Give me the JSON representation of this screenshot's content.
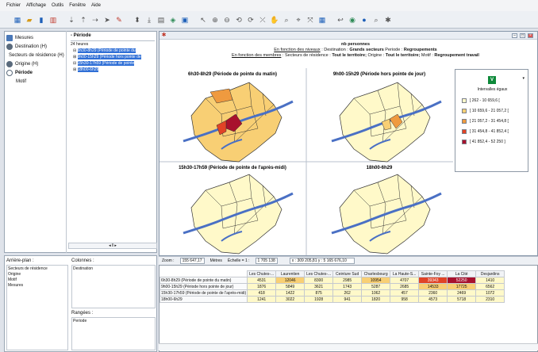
{
  "menu": [
    "Fichier",
    "Affichage",
    "Outils",
    "Fenêtre",
    "Aide"
  ],
  "toolbar_icons": [
    "new-icon",
    "open-icon",
    "save-icon",
    "chart-icon",
    "zoom-icon",
    "table-icon",
    "sort-icon",
    "filter-icon",
    "cursor-icon",
    "paint-icon",
    "pointer-icon",
    "select-icon",
    "report-icon",
    "map-icon",
    "grid-icon",
    "chart2-icon",
    "zoom-in-icon",
    "zoom-out-icon",
    "zoom-prev-icon",
    "zoom-next-icon",
    "pan-icon",
    "hand-icon",
    "zoom-box-icon",
    "zoom-all-icon",
    "layer-icon",
    "measure-icon",
    "info-icon",
    "label-icon",
    "find-icon",
    "print-icon"
  ],
  "dimensions": {
    "items": [
      {
        "label": "Mesures",
        "icon": "measures-icon"
      },
      {
        "label": "Destination (H)",
        "icon": "destination-icon"
      },
      {
        "label": "Secteurs de résidence (H)",
        "icon": "sector-icon"
      },
      {
        "label": "Origine (H)",
        "icon": "origin-icon"
      },
      {
        "label": "Période",
        "icon": "period-icon"
      },
      {
        "label": "Motif",
        "icon": ""
      }
    ]
  },
  "period": {
    "header": "Période",
    "root": "24 heures",
    "items": [
      "6h30-8h29 (Période de pointe du",
      "9h00-15h29 (Période hors pointe de",
      "15h30-17h59 (Période de pointe",
      "18h00-6h29"
    ]
  },
  "panes": {
    "background_label": "Arrière-plan :",
    "background_items": [
      "Secteurs de résidence",
      "Origine",
      "Motif",
      "Mesures"
    ],
    "columns_label": "Colonnes :",
    "columns_items": [
      "Destination"
    ],
    "rows_label": "Rangées :",
    "rows_items": [
      "Periode"
    ]
  },
  "map": {
    "measure": "nb personnes",
    "line2_prefix": "En fonction des niveaux",
    "line2_body": " : Destination : ",
    "line2_bold": "Grands secteurs",
    "line2_tail1": " Periode : ",
    "line2_bold2": "Regroupements",
    "line3_prefix": "En fonction des membres",
    "line3_body": " : Secteurs de résidence : ",
    "line3_bold": "Tout le territoire;",
    "line3_tail1": " Origine : ",
    "line3_bold2": "Tout le territoire;",
    "line3_tail2": " Motif : ",
    "line3_bold3": "Regroupement travail",
    "panels": [
      "6h30-8h29 (Période de pointe du matin)",
      "9h00-15h29 (Période hors pointe de jour)",
      "15h30-17h59 (Période de pointe de l'après-midi)",
      "18h00-6h29"
    ]
  },
  "legend": {
    "badge": "V",
    "title": "Intervalles égaux",
    "ranges": [
      {
        "label": "[ 262 - 10 659,6 [",
        "color": "#fff9c9"
      },
      {
        "label": "[ 10 659,6 - 21 057,2 [",
        "color": "#f8cf74"
      },
      {
        "label": "[ 21 057,2 - 31 454,8 [",
        "color": "#ef9a3f"
      },
      {
        "label": "[ 31 454,8 - 41 852,4 [",
        "color": "#e14326"
      },
      {
        "label": "[ 41 852,4 - 52 250 ]",
        "color": "#a8112d"
      }
    ]
  },
  "status": {
    "zoom_label": "Zoom :",
    "zoom_value": "155 647,17",
    "zoom_unit": "Mètres",
    "scale_label": "Échelle = 1 :",
    "scale_value": "1 705 138",
    "coords": "x : 309 205,81  y : 5 165 676,10"
  },
  "table": {
    "columns": [
      "Les Chutes-...",
      "Laurentien",
      "Les Chutes-...",
      "Ceinture Sud",
      "Charlesbourg",
      "La Haute-S...",
      "Sainte-Foy ...",
      "La Cité",
      "Desjardins"
    ],
    "rows": [
      {
        "label": "6h30-8h29 (Période de pointe du matin)",
        "values": [
          "4531",
          "12046",
          "8300",
          "2985",
          "10954",
          "4707",
          "39343",
          "52250",
          "1410"
        ]
      },
      {
        "label": "9h00-15h29 (Période hors pointe de jour)",
        "values": [
          "1876",
          "5849",
          "3621",
          "1743",
          "5287",
          "2685",
          "14533",
          "17725",
          "6562"
        ]
      },
      {
        "label": "15h30-17h59 (Période de pointe de l'après-midi)",
        "values": [
          "418",
          "1422",
          "875",
          "262",
          "1062",
          "457",
          "2360",
          "2469",
          "1072"
        ]
      },
      {
        "label": "18h00-6h29",
        "values": [
          "1241",
          "3022",
          "1928",
          "941",
          "1820",
          "958",
          "4573",
          "5718",
          "2310"
        ]
      }
    ]
  }
}
